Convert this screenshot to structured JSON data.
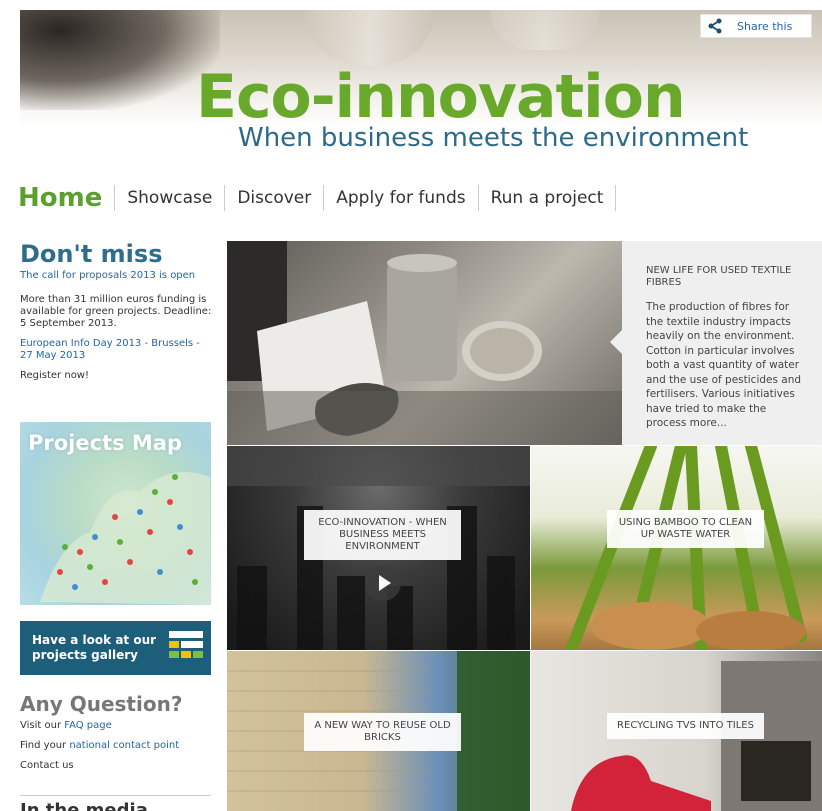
{
  "colors": {
    "brand_green": "#68a82a",
    "brand_blue": "#2d6a8a",
    "link": "#2266aa",
    "gallery_bg": "#1d5f7a"
  },
  "header": {
    "share_label": "Share this",
    "share_icon": "share-icon",
    "title": "Eco-innovation",
    "subtitle": "When business meets the environment"
  },
  "nav": {
    "items": [
      {
        "label": "Home"
      },
      {
        "label": "Showcase"
      },
      {
        "label": "Discover"
      },
      {
        "label": "Apply for funds"
      },
      {
        "label": "Run a project"
      }
    ]
  },
  "sidebar": {
    "dont_miss": {
      "title": "Don't miss",
      "call_link": "The call for proposals 2013 is open",
      "funding_text": "More than 31 million euros funding is available for green projects. Deadline: 5 September 2013.",
      "info_day_link": "European Info Day 2013 - Brussels - 27 May 2013",
      "register_text": "Register now!"
    },
    "map_title": "Projects Map",
    "gallery_label": "Have a look at our projects gallery",
    "any_question": {
      "title": "Any Question?",
      "faq_prefix": "Visit our ",
      "faq_link": "FAQ page",
      "contact_prefix": "Find your ",
      "contact_link": "national contact point",
      "contact_us": "Contact us"
    },
    "cut_title": "In the media"
  },
  "featured": {
    "title": "NEW LIFE FOR USED TEXTILE FIBRES",
    "body": "The production of fibres for the textile industry impacts heavily on the environment. Cotton in particular involves both a vast quantity of water and the use of pesticides and fertilisers. Various initiatives have tried to make the process more..."
  },
  "tiles": {
    "video_caption": "ECO-INNOVATION - WHEN BUSINESS MEETS ENVIRONMENT",
    "bamboo_caption": "USING BAMBOO TO CLEAN UP WASTE WATER",
    "bricks_caption": "A NEW WAY TO REUSE OLD BRICKS",
    "tvs_caption": "RECYCLING TVS INTO TILES"
  }
}
